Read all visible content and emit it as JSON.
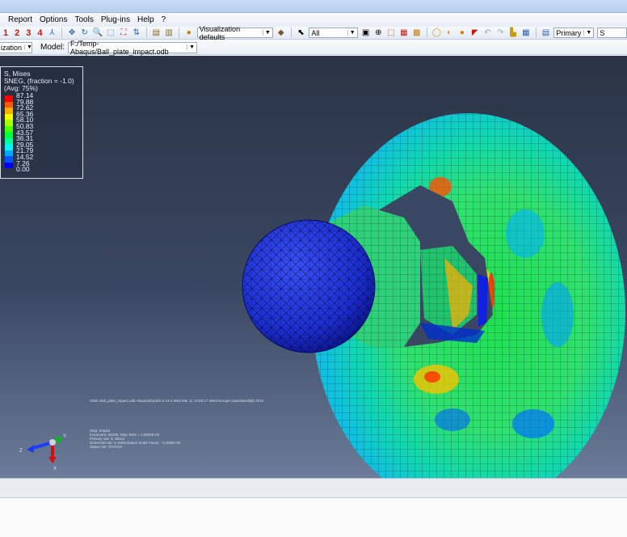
{
  "menu": {
    "items": [
      "Report",
      "Options",
      "Tools",
      "Plug-ins",
      "Help",
      "?"
    ]
  },
  "toolbar": {
    "numbers": [
      "1",
      "2",
      "3",
      "4"
    ],
    "visualization_defaults": "Visualization defaults",
    "selection_filter": "All",
    "primary": "Primary",
    "primary_variable": "S"
  },
  "context": {
    "module_value": "ization",
    "model_label": "Model:",
    "model_value": "F:/Temp-Abaqus/Ball_plate_impact.odb"
  },
  "legend": {
    "title_lines": [
      "S, Mises",
      "SNEG, (fraction = -1.0)",
      "(Avg: 75%)"
    ],
    "values": [
      "87.14",
      "79.88",
      "72.62",
      "65.36",
      "58.10",
      "50.83",
      "43.57",
      "36.31",
      "29.05",
      "21.79",
      "14.52",
      "7.26",
      "0.00"
    ],
    "colors": [
      "#ff0000",
      "#ff5a00",
      "#ffae00",
      "#f5ff00",
      "#a6ff00",
      "#4cff00",
      "#00ff39",
      "#00ff9a",
      "#00f7f2",
      "#00a8ff",
      "#0055ff",
      "#0000ff"
    ]
  },
  "odb_line": "ODB: Ball_plate_impact.odb    Abaqus/Explicit 6.14-2    Wed Mar 11 14:58:17 West-Europe (standaardtijd) 2015",
  "step_info": [
    "Step: Impact",
    "Increment:    28238: Step Time =   1.0000E-03",
    "Primary Var: S, Mises",
    "Deformed Var: U   Deformation Scale Factor: +1.000e+00",
    "Status Var: STATUS"
  ],
  "triad": {
    "y": "Y",
    "z": "Z",
    "x": "X"
  },
  "colors": {
    "viewport_top": "#2b3446",
    "viewport_bottom": "#6a7c99",
    "ball": "#1d2fd0"
  }
}
